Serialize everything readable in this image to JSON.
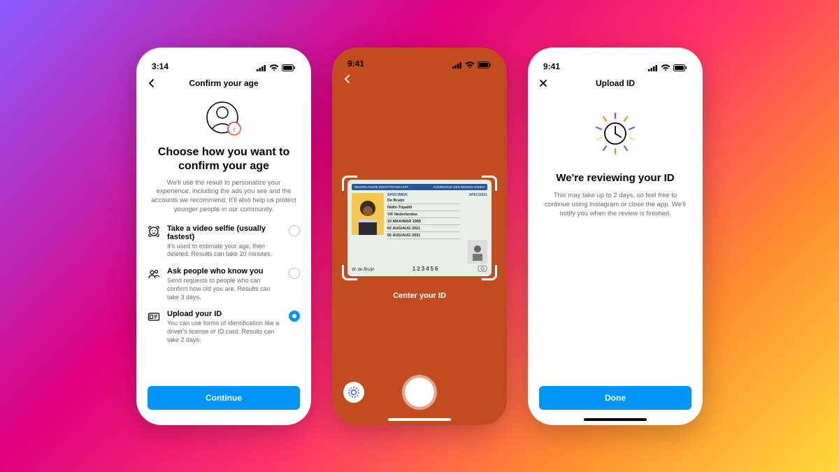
{
  "p1": {
    "status_time": "3:14",
    "nav_title": "Confirm your age",
    "heading": "Choose how you want to confirm your age",
    "subtitle": "We'll use the result to personalize your experience, including the ads you see and the accounts we recommend. It'll also help us protect younger people in our community.",
    "options": [
      {
        "title": "Take a video selfie (usually fastest)",
        "desc": "It's used to estimate your age, then deleted. Results can take 20 minutes.",
        "selected": false
      },
      {
        "title": "Ask people who know you",
        "desc": "Send requests to people who can confirm how old you are. Results can take 3 days.",
        "selected": false
      },
      {
        "title": "Upload your ID",
        "desc": "You can use forms of identification like a driver's license or ID card. Results can take 2 days.",
        "selected": true
      }
    ],
    "cta": "Continue"
  },
  "p2": {
    "status_time": "9:41",
    "instruction": "Center your ID",
    "id_card": {
      "header_left": "NEDERLANDSE IDENTITEITSKAART",
      "header_right": "KONINKRIJK DER NEDERLANDEN",
      "doc_code": "SPECI2021",
      "specimen": "SPECIMEN",
      "surname": "De Bruijn",
      "given_names": "Nidhi-Tripathi",
      "sex_nationality": "V/F   Nederlandse",
      "dob": "10 MAA/MAR 1965",
      "doi": "02 AUG/AUG 2021",
      "doe": "02 AUG/AUG 2031",
      "signature": "W. de Bruijn",
      "number": "123456"
    }
  },
  "p3": {
    "status_time": "9:41",
    "nav_title": "Upload ID",
    "heading": "We're reviewing your ID",
    "subtitle": "This may take up to 2 days, so feel free to continue using Instagram or close the app. We'll notify you when the review is finished.",
    "cta": "Done"
  }
}
